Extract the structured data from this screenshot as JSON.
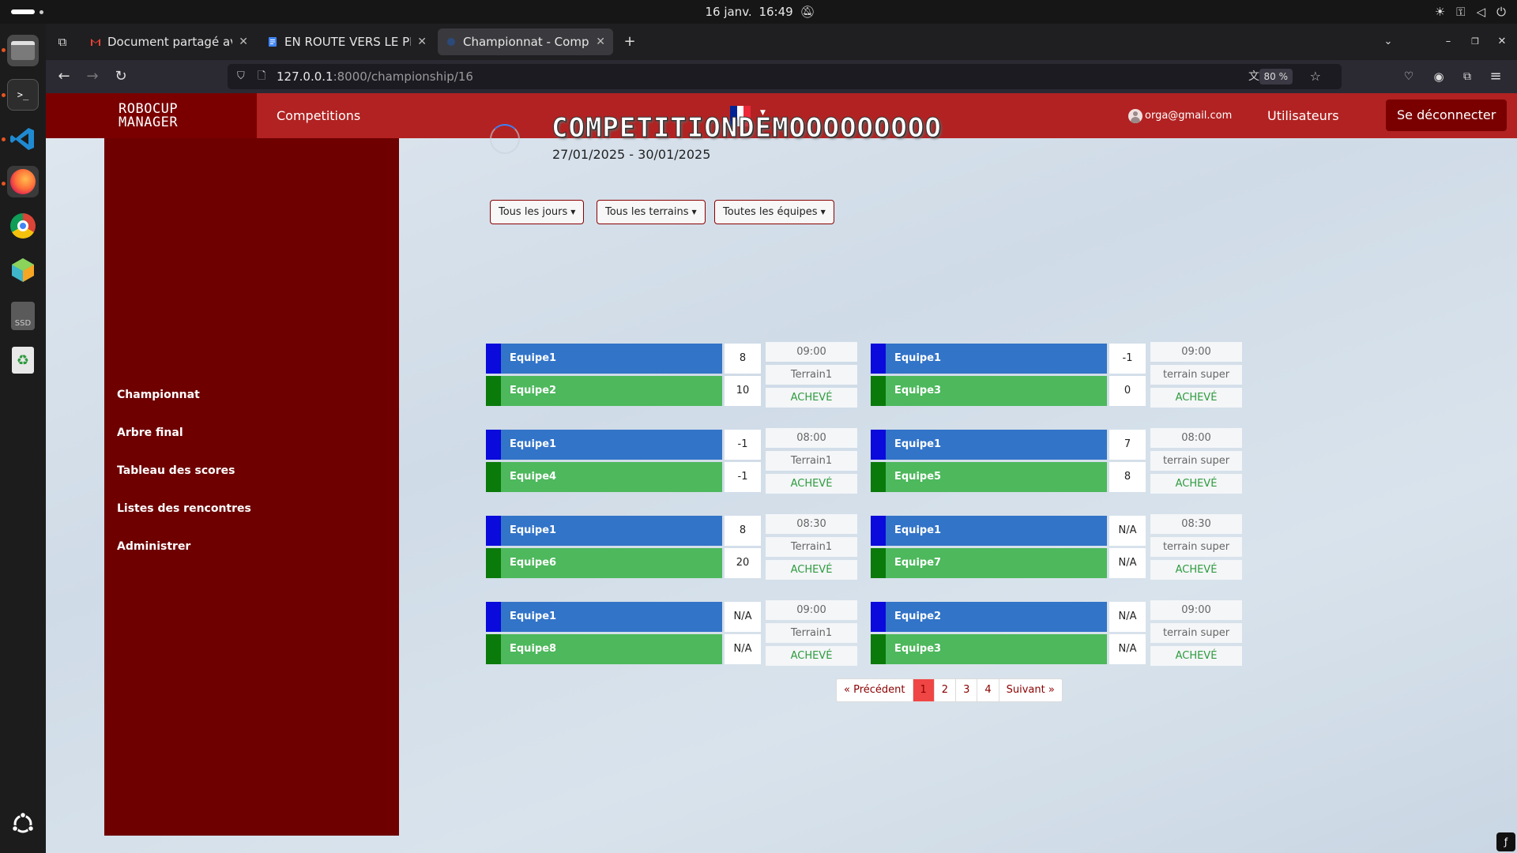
{
  "system": {
    "date": "16 janv.",
    "time": "16:49"
  },
  "dock": {
    "items": [
      "files-icon",
      "terminal-icon",
      "vscode-icon",
      "firefox-icon",
      "chrome-icon",
      "app-icon",
      "ssd-icon",
      "trash-icon",
      "ubuntu-icon"
    ],
    "ssd_label": "SSD"
  },
  "browser": {
    "tabs": [
      {
        "label": "Document partagé avec v",
        "favicon": "gmail-icon"
      },
      {
        "label": "EN ROUTE VERS LE PROC",
        "favicon": "docs-icon"
      },
      {
        "label": "Championnat - Competiti",
        "favicon": "loading-icon"
      }
    ],
    "url_host": "127.0.0.1",
    "url_rest": ":8000/championship/16",
    "zoom": "80 %"
  },
  "site": {
    "brand_line1": "ROBOCUP",
    "brand_line2": "MANAGER",
    "nav_competitions": "Competitions",
    "user_email": "orga@gmail.com",
    "nav_users": "Utilisateurs",
    "logout": "Se déconnecter",
    "flag_colors": [
      "#002395",
      "#ffffff",
      "#ed2939"
    ]
  },
  "sidebar": {
    "items": [
      "Championnat",
      "Arbre final",
      "Tableau des scores",
      "Listes des rencontres",
      "Administrer"
    ]
  },
  "competition": {
    "title": "COMPETITIONDEMOOOOOOOOO",
    "dates": "27/01/2025 - 30/01/2025"
  },
  "filters": {
    "days": "Tous les jours",
    "fields": "Tous les terrains",
    "teams": "Toutes les équipes"
  },
  "matches": [
    {
      "team1": "Equipe1",
      "team2": "Equipe2",
      "score1": "8",
      "score2": "10",
      "time": "09:00",
      "field": "Terrain1",
      "status": "ACHEVÉ"
    },
    {
      "team1": "Equipe1",
      "team2": "Equipe3",
      "score1": "-1",
      "score2": "0",
      "time": "09:00",
      "field": "terrain super",
      "status": "ACHEVÉ"
    },
    {
      "team1": "Equipe1",
      "team2": "Equipe4",
      "score1": "-1",
      "score2": "-1",
      "time": "08:00",
      "field": "Terrain1",
      "status": "ACHEVÉ"
    },
    {
      "team1": "Equipe1",
      "team2": "Equipe5",
      "score1": "7",
      "score2": "8",
      "time": "08:00",
      "field": "terrain super",
      "status": "ACHEVÉ"
    },
    {
      "team1": "Equipe1",
      "team2": "Equipe6",
      "score1": "8",
      "score2": "20",
      "time": "08:30",
      "field": "Terrain1",
      "status": "ACHEVÉ"
    },
    {
      "team1": "Equipe1",
      "team2": "Equipe7",
      "score1": "N/A",
      "score2": "N/A",
      "time": "08:30",
      "field": "terrain super",
      "status": "ACHEVÉ"
    },
    {
      "team1": "Equipe1",
      "team2": "Equipe8",
      "score1": "N/A",
      "score2": "N/A",
      "time": "09:00",
      "field": "Terrain1",
      "status": "ACHEVÉ"
    },
    {
      "team1": "Equipe2",
      "team2": "Equipe3",
      "score1": "N/A",
      "score2": "N/A",
      "time": "09:00",
      "field": "terrain super",
      "status": "ACHEVÉ"
    }
  ],
  "pagination": {
    "prev": "« Précédent",
    "pages": [
      "1",
      "2",
      "3",
      "4"
    ],
    "current": "1",
    "next": "Suivant »"
  }
}
